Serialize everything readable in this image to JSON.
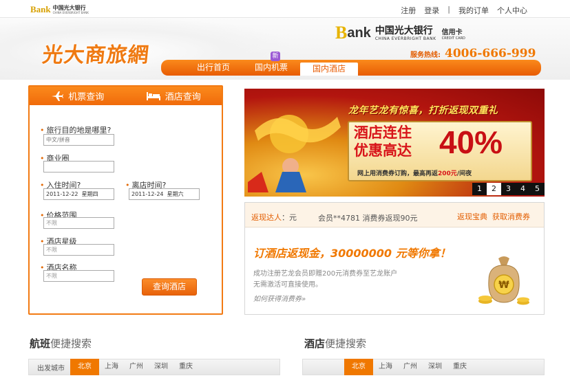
{
  "topbar": {
    "mini_logo_text1": "中国光大银行",
    "mini_logo_text2": "CHINA EVERBRIGHT BANK",
    "links": [
      "注册",
      "登录",
      "我的订单",
      "个人中心"
    ]
  },
  "header": {
    "site_logo": "光大商旅網",
    "bank_name_cn": "中国光大银行",
    "bank_name_en": "CHINA EVERBRIGHT BANK",
    "card_label": "信用卡",
    "card_label_en": "CREDIT CARD",
    "hotline_label": "服务热线:",
    "hotline_number": "4006-666-999",
    "new_badge": "新"
  },
  "nav": {
    "tabs": [
      {
        "label": "出行首页",
        "active": false
      },
      {
        "label": "国内机票",
        "active": false
      },
      {
        "label": "国内酒店",
        "active": true
      }
    ]
  },
  "search": {
    "tabs": [
      "机票查询",
      "酒店查询"
    ],
    "fields": {
      "destination_label": "旅行目的地是哪里?",
      "destination_placeholder": "中文/拼音",
      "district_label": "商业圈",
      "checkin_label": "入住时间?",
      "checkin_value": "2011-12-22  星期四",
      "checkout_label": "离店时间?",
      "checkout_value": "2011-12-24  星期六",
      "price_label": "价格范围",
      "price_value": "不限",
      "star_label": "酒店星级",
      "star_value": "不限",
      "name_label": "酒店名称",
      "name_value": "不限"
    },
    "submit": "查询酒店"
  },
  "banner": {
    "title": "龙年艺龙有惊喜，打折返现双重礼",
    "line1": "酒店连住",
    "line2": "优惠高达",
    "percent": "40%",
    "small_prefix": "网上用消费券订购，最高再返",
    "small_amount": "200元",
    "small_suffix": "/间夜",
    "pages": [
      "1",
      "2",
      "3",
      "4",
      "5"
    ],
    "active_page": "2"
  },
  "cashback": {
    "label": "返现达人",
    "label_suffix": "：元",
    "member": "会员**4781 消费券返现90元",
    "links": [
      "返现宝典",
      "获取消费券"
    ],
    "headline": "订酒店返现金，30000000 元等你拿！",
    "desc1": "成功注册艺龙会员即赠200元消费券至艺龙账户",
    "desc2": "无需激活可直接使用。",
    "how": "如何获得消费券»",
    "coin_symbol": "₩"
  },
  "flight_quick": {
    "title_bold": "航班",
    "title_rest": "便捷搜索",
    "city_label": "出发城市",
    "cities": [
      "北京",
      "上海",
      "广州",
      "深圳",
      "重庆"
    ],
    "active_city": "北京"
  },
  "hotel_quick": {
    "title_bold": "酒店",
    "title_rest": "便捷搜索",
    "cities": [
      "北京",
      "上海",
      "广州",
      "深圳",
      "重庆"
    ],
    "active_city": "北京"
  },
  "colors": {
    "accent": "#f07800",
    "nav_orange": "#e85c04",
    "banner_red": "#d8141a",
    "brand_gold": "#e7b300"
  }
}
